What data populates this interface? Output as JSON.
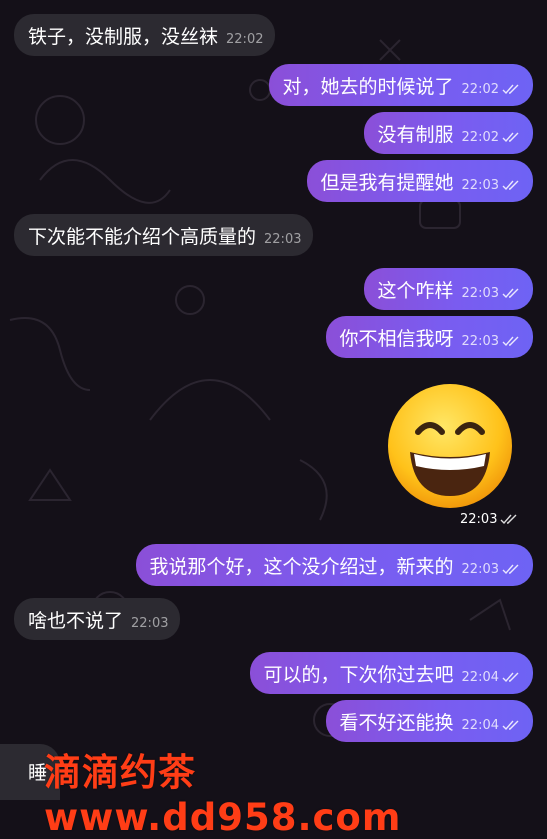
{
  "messages": [
    {
      "text": "铁子，没制服，没丝袜",
      "time": "22:02",
      "dir": "in"
    },
    {
      "text": "对，她去的时候说了",
      "time": "22:02",
      "dir": "out"
    },
    {
      "text": "没有制服",
      "time": "22:02",
      "dir": "out"
    },
    {
      "text": "但是我有提醒她",
      "time": "22:03",
      "dir": "out"
    },
    {
      "text": "下次能不能介绍个高质量的",
      "time": "22:03",
      "dir": "in"
    },
    {
      "text": "这个咋样",
      "time": "22:03",
      "dir": "out"
    },
    {
      "text": "你不相信我呀",
      "time": "22:03",
      "dir": "out"
    },
    {
      "text": "我说那个好，这个没介绍过，新来的",
      "time": "22:03",
      "dir": "out"
    },
    {
      "text": "啥也不说了",
      "time": "22:03",
      "dir": "in"
    },
    {
      "text": "可以的，下次你过去吧",
      "time": "22:04",
      "dir": "out"
    },
    {
      "text": "看不好还能换",
      "time": "22:04",
      "dir": "out"
    }
  ],
  "emoji_message": {
    "emoji": "grinning-face-with-smiling-eyes",
    "time": "22:03"
  },
  "partial_message": {
    "text": "睡"
  },
  "watermark": "滴滴约茶 www.dd958.com"
}
